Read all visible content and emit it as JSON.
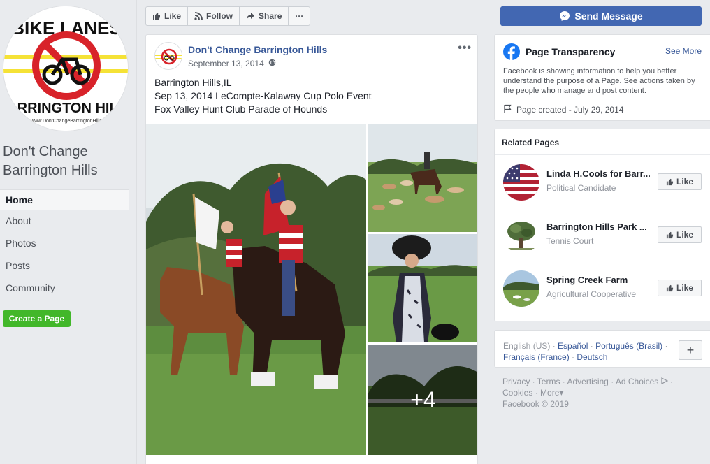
{
  "page": {
    "name": "Don't Change Barrington Hills",
    "profile_logo": {
      "top_text": "BIKE LANES",
      "bottom_text": "BARRINGTON HILLS",
      "url_text": "www.DontChangeBarringtonHills"
    }
  },
  "sidebar": {
    "items": [
      {
        "label": "Home",
        "active": true
      },
      {
        "label": "About"
      },
      {
        "label": "Photos"
      },
      {
        "label": "Posts"
      },
      {
        "label": "Community"
      }
    ],
    "create_page": "Create a Page"
  },
  "actions": {
    "like": "Like",
    "follow": "Follow",
    "share": "Share",
    "more": "···",
    "send_message": "Send Message"
  },
  "post": {
    "author": "Don't Change Barrington Hills",
    "date": "September 13, 2014",
    "menu": "•••",
    "lines": [
      "Barrington Hills,IL",
      "Sep 13, 2014 LeCompte-Kalaway Cup Polo Event",
      "Fox Valley Hunt Club Parade of Hounds"
    ],
    "more_photos": "+4"
  },
  "transparency": {
    "title": "Page Transparency",
    "see_more": "See More",
    "description": "Facebook is showing information to help you better understand the purpose of a Page. See actions taken by the people who manage and post content.",
    "created": "Page created - July 29, 2014"
  },
  "related": {
    "title": "Related Pages",
    "like_label": "Like",
    "items": [
      {
        "name": "Linda H.Cools for Barr...",
        "category": "Political Candidate"
      },
      {
        "name": "Barrington Hills Park ...",
        "category": "Tennis Court"
      },
      {
        "name": "Spring Creek Farm",
        "category": "Agricultural Cooperative"
      }
    ]
  },
  "languages": {
    "current": "English (US)",
    "sep": " · ",
    "others": [
      "Español",
      "Português (Brasil)",
      "Français (France)",
      "Deutsch"
    ],
    "add": "+"
  },
  "footer": {
    "links": [
      "Privacy",
      "Terms",
      "Advertising",
      "Ad Choices",
      "Cookies",
      "More"
    ],
    "copyright": "Facebook © 2019"
  },
  "colors": {
    "brand": "#4267b2",
    "link": "#385898",
    "green": "#42b72a"
  }
}
